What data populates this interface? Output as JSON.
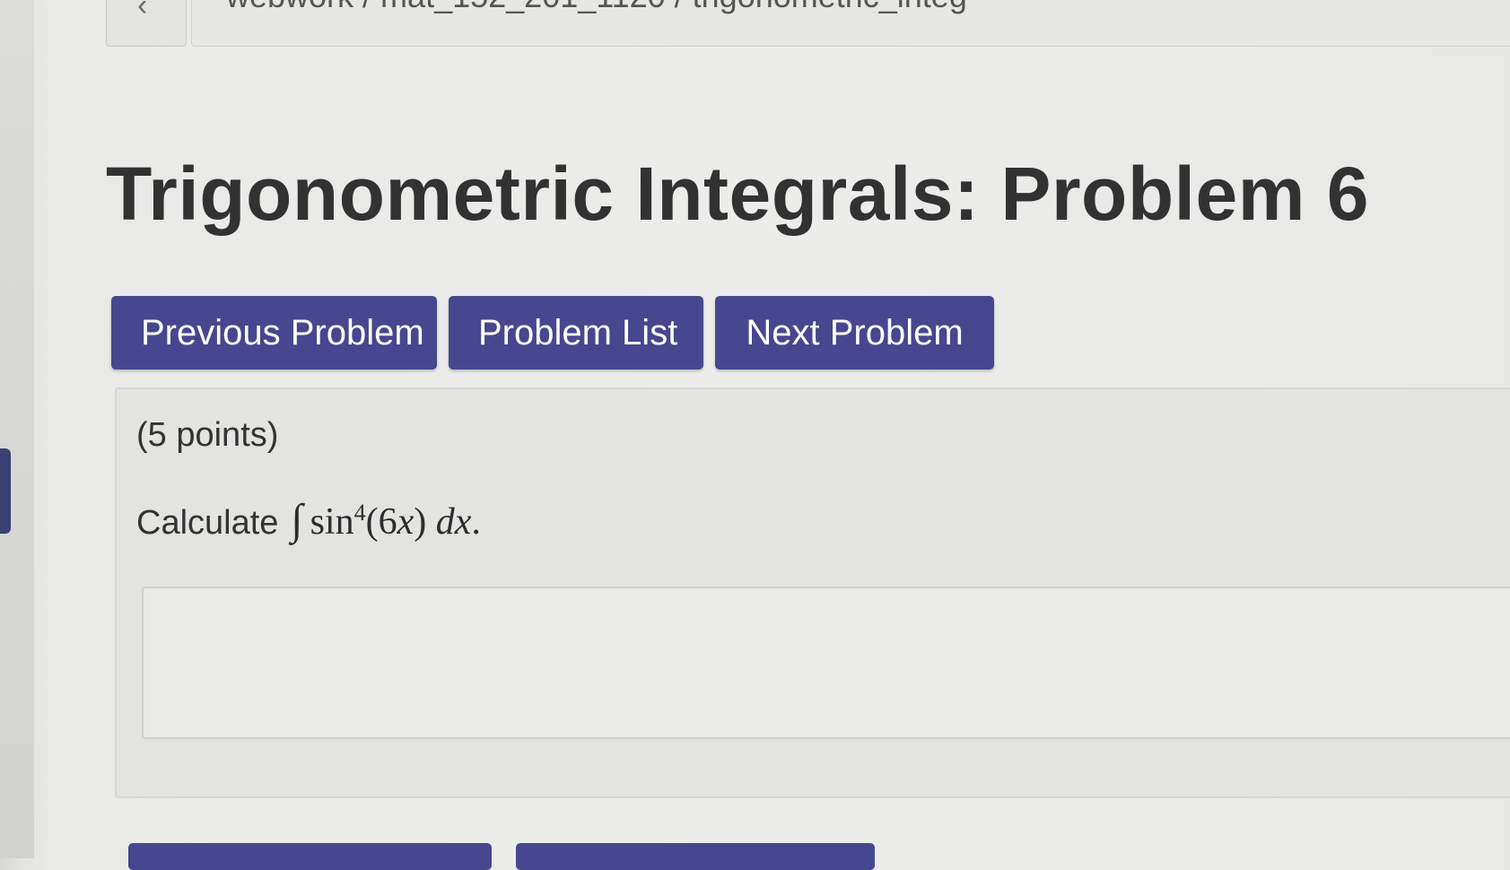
{
  "header": {
    "back_icon": "chevron-left-icon",
    "breadcrumb": "webwork / mat_152_201_1120 / trigonometric_integ"
  },
  "page_title": "Trigonometric Integrals: Problem 6",
  "nav": {
    "previous_label": "Previous Problem",
    "list_label": "Problem List",
    "next_label": "Next Problem"
  },
  "problem": {
    "points": "(5 points)",
    "prompt": "Calculate",
    "integral_symbol": "∫",
    "func": "sin",
    "exponent": "4",
    "argument": "(6",
    "argument_var": "x",
    "argument_close": ")",
    "differential": "dx",
    "period": "."
  },
  "answer": {
    "value": ""
  },
  "colors": {
    "button_bg": "#46478f",
    "button_text": "#ffffff",
    "title": "#323232",
    "panel_bg": "#e3e3e1"
  }
}
